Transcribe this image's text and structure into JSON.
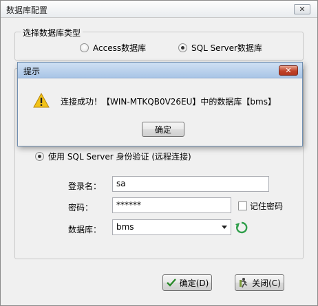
{
  "window": {
    "title": "数据库配置",
    "close_glyph": "✕"
  },
  "db_type": {
    "legend": "选择数据库类型",
    "options": [
      {
        "label": "Access数据库",
        "checked": false
      },
      {
        "label": "SQL Server数据库",
        "checked": true
      }
    ]
  },
  "auth": {
    "sql_server_auth_label": "使用 SQL Server 身份验证 (远程连接)",
    "login_label": "登录名：",
    "login_value": "sa",
    "password_label": "密码：",
    "password_value": "******",
    "remember_label": "记住密码",
    "database_label": "数据库：",
    "database_value": "bms"
  },
  "buttons": {
    "ok_label": "确定(D)",
    "close_label": "关闭(C)"
  },
  "dialog": {
    "title": "提示",
    "close_glyph": "✕",
    "message": "连接成功！【WIN-MTKQB0V26EU】中的数据库【bms】",
    "ok_label": "确定"
  },
  "colors": {
    "accent": "#a9c5e6",
    "close_red": "#c0432a",
    "warning_yellow": "#f2c318",
    "refresh_green": "#2e9e4a"
  },
  "icons": {
    "warning": "warning-icon",
    "refresh": "refresh-icon",
    "ok": "check-icon",
    "close": "exit-icon"
  }
}
